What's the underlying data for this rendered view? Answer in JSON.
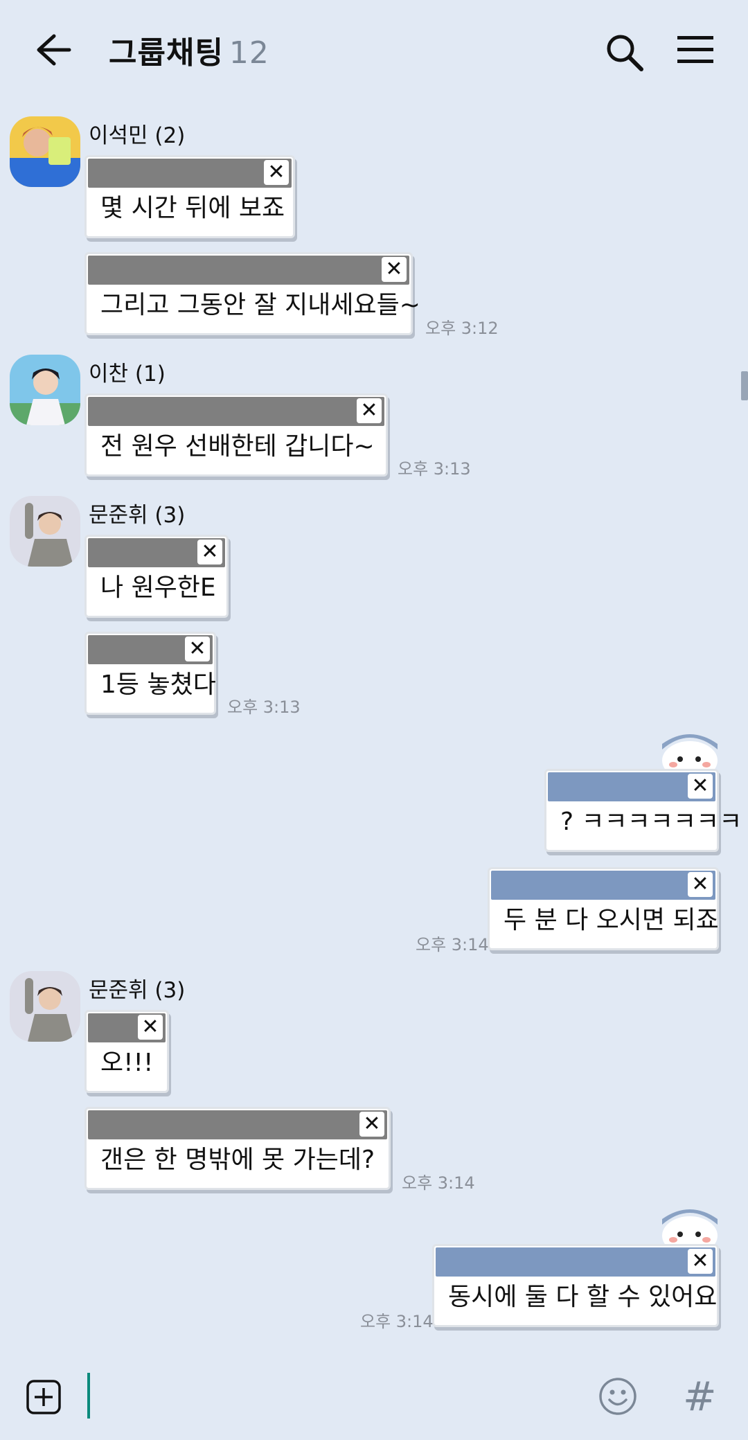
{
  "header": {
    "title": "그룹채팅",
    "member_count": "12",
    "back_icon": "arrow-left-icon",
    "search_icon": "search-icon",
    "menu_icon": "hamburger-menu-icon"
  },
  "messages": [
    {
      "sender": "이석민 (2)",
      "text": "몇 시간 뒤에 보죠",
      "time": ""
    },
    {
      "text": "그리고 그동안 잘 지내세요들~",
      "time": "오후 3:12"
    },
    {
      "sender": "이찬 (1)",
      "text": "전 원우 선배한테 갑니다~",
      "time": "오후 3:13"
    },
    {
      "sender": "문준휘 (3)",
      "text": "나 원우한E",
      "time": ""
    },
    {
      "text": "1등 놓쳤다",
      "time": "오후 3:13"
    },
    {
      "text": "? ㅋㅋㅋㅋㅋㅋㅋ",
      "time": ""
    },
    {
      "text": "두 분 다 오시면 되죠",
      "time": "오후 3:14"
    },
    {
      "sender": "문준휘 (3)",
      "text": "오!!!",
      "time": ""
    },
    {
      "text": "갠은 한 명밖에 못 가는데?",
      "time": "오후 3:14"
    },
    {
      "text": "동시에 둘 다 할 수 있어요",
      "time": "오후 3:14"
    }
  ],
  "close_glyph": "✕",
  "input": {
    "plus_icon": "plus-square-icon",
    "emoji_icon": "smiley-icon",
    "hash_label": "#"
  },
  "colors": {
    "background": "#e1e9f4",
    "other_bar": "#7f7f7f",
    "my_bar": "#7d98c0",
    "cursor": "#0b8a7c"
  }
}
